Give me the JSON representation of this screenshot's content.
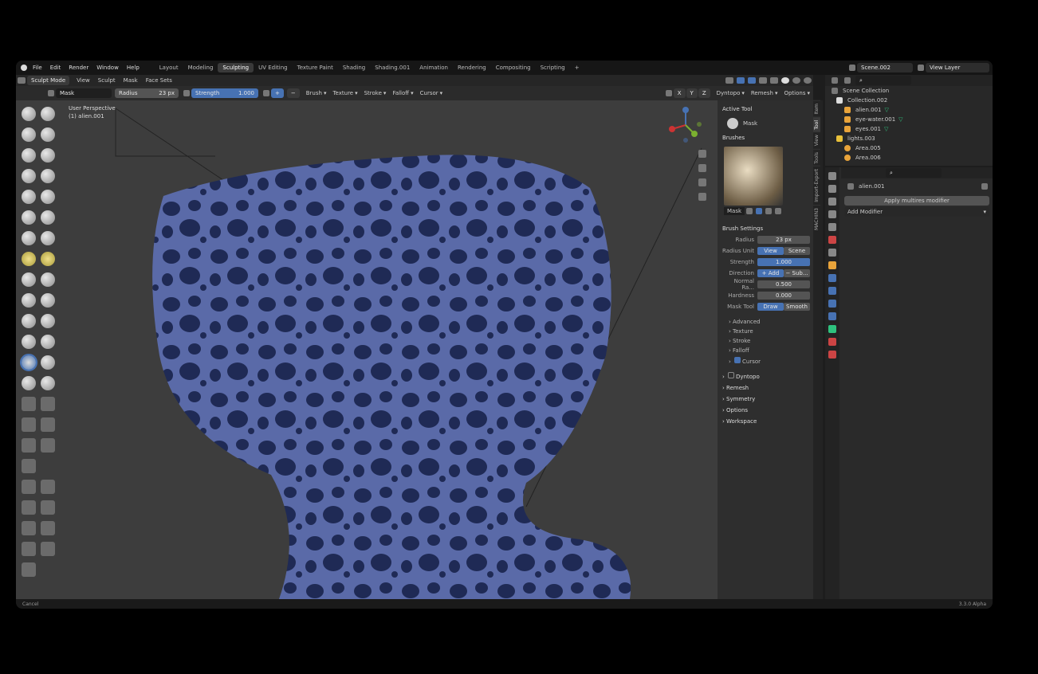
{
  "topbar": {
    "menus": [
      "File",
      "Edit",
      "Render",
      "Window",
      "Help"
    ],
    "workspaces": [
      "Layout",
      "Modeling",
      "Sculpting",
      "UV Editing",
      "Texture Paint",
      "Shading",
      "Shading.001",
      "Animation",
      "Rendering",
      "Compositing",
      "Scripting"
    ],
    "active_workspace_index": 2,
    "add_tab": "+",
    "scene": "Scene.002",
    "view_layer": "View Layer"
  },
  "header": {
    "mode": "Sculpt Mode",
    "menus": [
      "View",
      "Sculpt",
      "Mask",
      "Face Sets"
    ]
  },
  "toolsettings": {
    "brush_name": "Mask",
    "radius_label": "Radius",
    "radius_value": "23 px",
    "strength_label": "Strength",
    "strength_value": "1.000",
    "plus": "+",
    "minus": "−",
    "dropdowns": [
      "Brush",
      "Texture",
      "Stroke",
      "Falloff",
      "Cursor"
    ],
    "axes": [
      "X",
      "Y",
      "Z"
    ],
    "dyntopo": "Dyntopo",
    "remesh": "Remesh",
    "options": "Options"
  },
  "viewport": {
    "perspective": "User Perspective",
    "object": "(1) alien.001"
  },
  "npanel": {
    "active_tool": "Active Tool",
    "tool_name": "Mask",
    "brushes": "Brushes",
    "brush_label": "Mask",
    "brush_settings": "Brush Settings",
    "rows": [
      {
        "label": "Radius",
        "value": "23 px",
        "blue": false
      },
      {
        "label": "Radius Unit",
        "value": "View",
        "value2": "Scene",
        "blue": true
      },
      {
        "label": "Strength",
        "value": "1.000",
        "blue": true
      },
      {
        "label": "Direction",
        "value": "+ Add",
        "value2": "− Sub...",
        "blue": true
      },
      {
        "label": "Normal Ra...",
        "value": "0.500",
        "blue": false
      },
      {
        "label": "Hardness",
        "value": "0.000",
        "blue": false
      },
      {
        "label": "Mask Tool",
        "value": "Draw",
        "value2": "Smooth",
        "blue": true
      }
    ],
    "subsections": [
      "Advanced",
      "Texture",
      "Stroke",
      "Falloff",
      "Cursor"
    ],
    "sections": [
      "Dyntopo",
      "Remesh",
      "Symmetry",
      "Options",
      "Workspace"
    ]
  },
  "vtabs": [
    "Item",
    "Tool",
    "View",
    "Tools",
    "Import-Export",
    "MACHIN3"
  ],
  "outliner": {
    "title": "Scene Collection",
    "rows": [
      "Collection.002",
      "alien.001",
      "eye-water.001",
      "eyes.001",
      "lights.003",
      "Area.005",
      "Area.006"
    ]
  },
  "properties": {
    "object": "alien.001",
    "apply_button": "Apply multires modifier",
    "add_modifier": "Add Modifier"
  },
  "status": {
    "left": "Cancel",
    "right": "3.3.0 Alpha"
  }
}
